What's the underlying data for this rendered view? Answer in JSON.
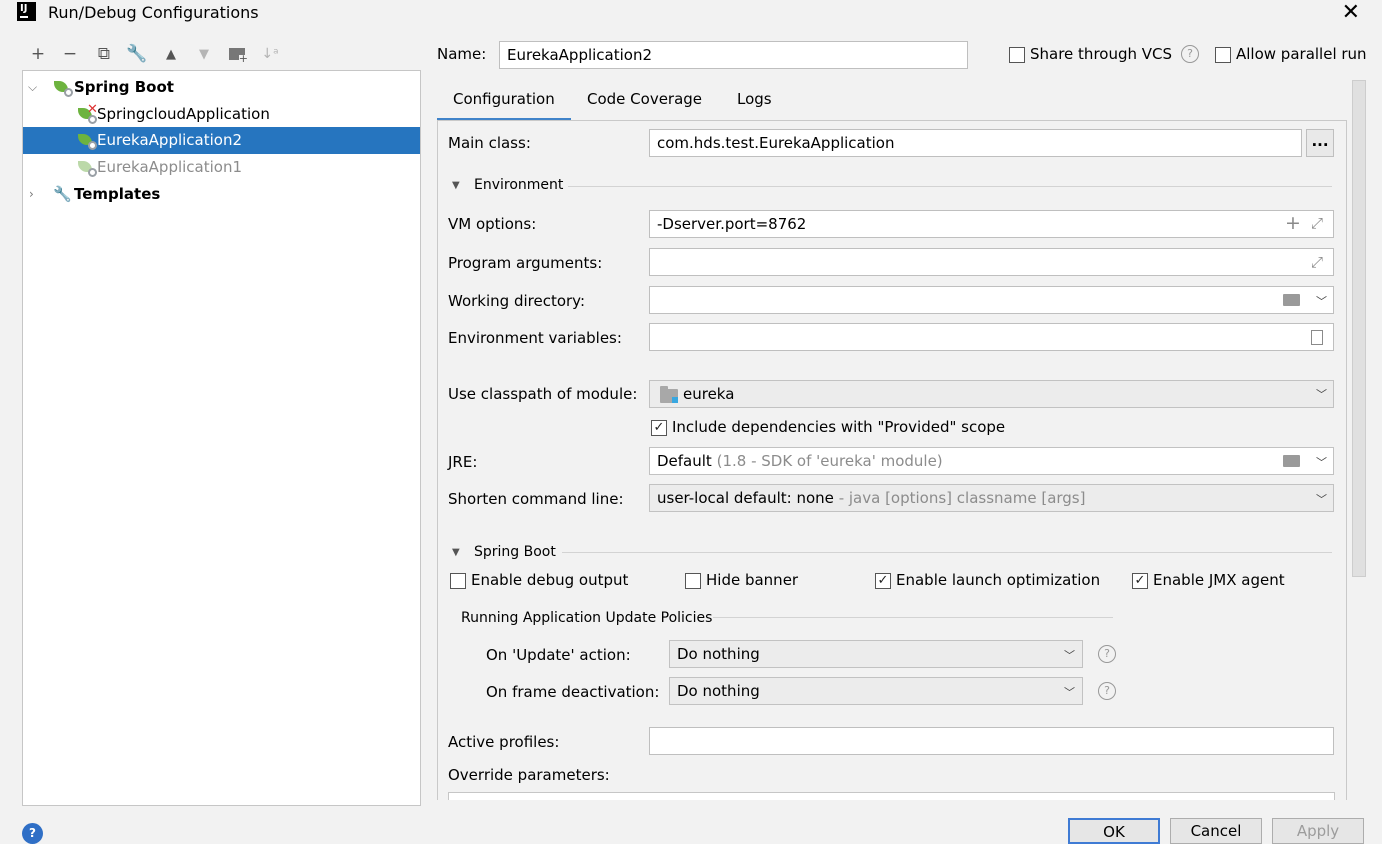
{
  "window": {
    "title": "Run/Debug Configurations",
    "app_icon": "intellij-icon"
  },
  "toolbar": {
    "items": [
      "add-icon",
      "remove-icon",
      "copy-icon",
      "wrench-icon",
      "move-up-icon",
      "move-down-icon",
      "folder-add-icon",
      "sort-icon"
    ]
  },
  "tree": {
    "root": "Spring Boot",
    "children": [
      "SpringcloudApplication",
      "EurekaApplication2",
      "EurekaApplication1"
    ],
    "templates": "Templates",
    "selected": "EurekaApplication2"
  },
  "name": {
    "label": "Name:",
    "value": "EurekaApplication2"
  },
  "share_vcs": {
    "label": "Share through VCS",
    "checked": false
  },
  "allow_parallel": {
    "label": "Allow parallel run",
    "checked": false
  },
  "tabs": [
    "Configuration",
    "Code Coverage",
    "Logs"
  ],
  "main_class": {
    "label": "Main class:",
    "value": "com.hds.test.EurekaApplication",
    "button": "..."
  },
  "environment": {
    "header": "Environment",
    "vm_label": "VM options:",
    "vm_value": "-Dserver.port=8762",
    "program_args_label": "Program arguments:",
    "program_args_value": "",
    "working_dir_label": "Working directory:",
    "working_dir_value": "",
    "env_vars_label": "Environment variables:",
    "env_vars_value": ""
  },
  "module": {
    "label": "Use classpath of module:",
    "value": "eureka",
    "include_deps_label": "Include dependencies with \"Provided\" scope",
    "include_deps_checked": true
  },
  "jre": {
    "label": "JRE:",
    "value": "Default",
    "hint": "(1.8 - SDK of 'eureka' module)"
  },
  "shorten": {
    "label": "Shorten command line:",
    "value": "user-local default: none",
    "hint": "- java [options] classname [args]"
  },
  "spring_boot": {
    "header": "Spring Boot",
    "debug_output": {
      "label": "Enable debug output",
      "checked": false
    },
    "hide_banner": {
      "label": "Hide banner",
      "checked": false
    },
    "launch_opt": {
      "label": "Enable launch optimization",
      "checked": true
    },
    "jmx_agent": {
      "label": "Enable JMX agent",
      "checked": true
    }
  },
  "policies": {
    "header": "Running Application Update Policies",
    "update_label": "On 'Update' action:",
    "update_value": "Do nothing",
    "frame_label": "On frame deactivation:",
    "frame_value": "Do nothing"
  },
  "active_profiles": {
    "label": "Active profiles:",
    "value": ""
  },
  "override_params": {
    "label": "Override parameters:"
  },
  "buttons": {
    "ok": "OK",
    "cancel": "Cancel",
    "apply": "Apply"
  },
  "colors": {
    "selection": "#2675bf",
    "spring_green": "#6db33f",
    "focus_blue": "#3f7bd4"
  }
}
